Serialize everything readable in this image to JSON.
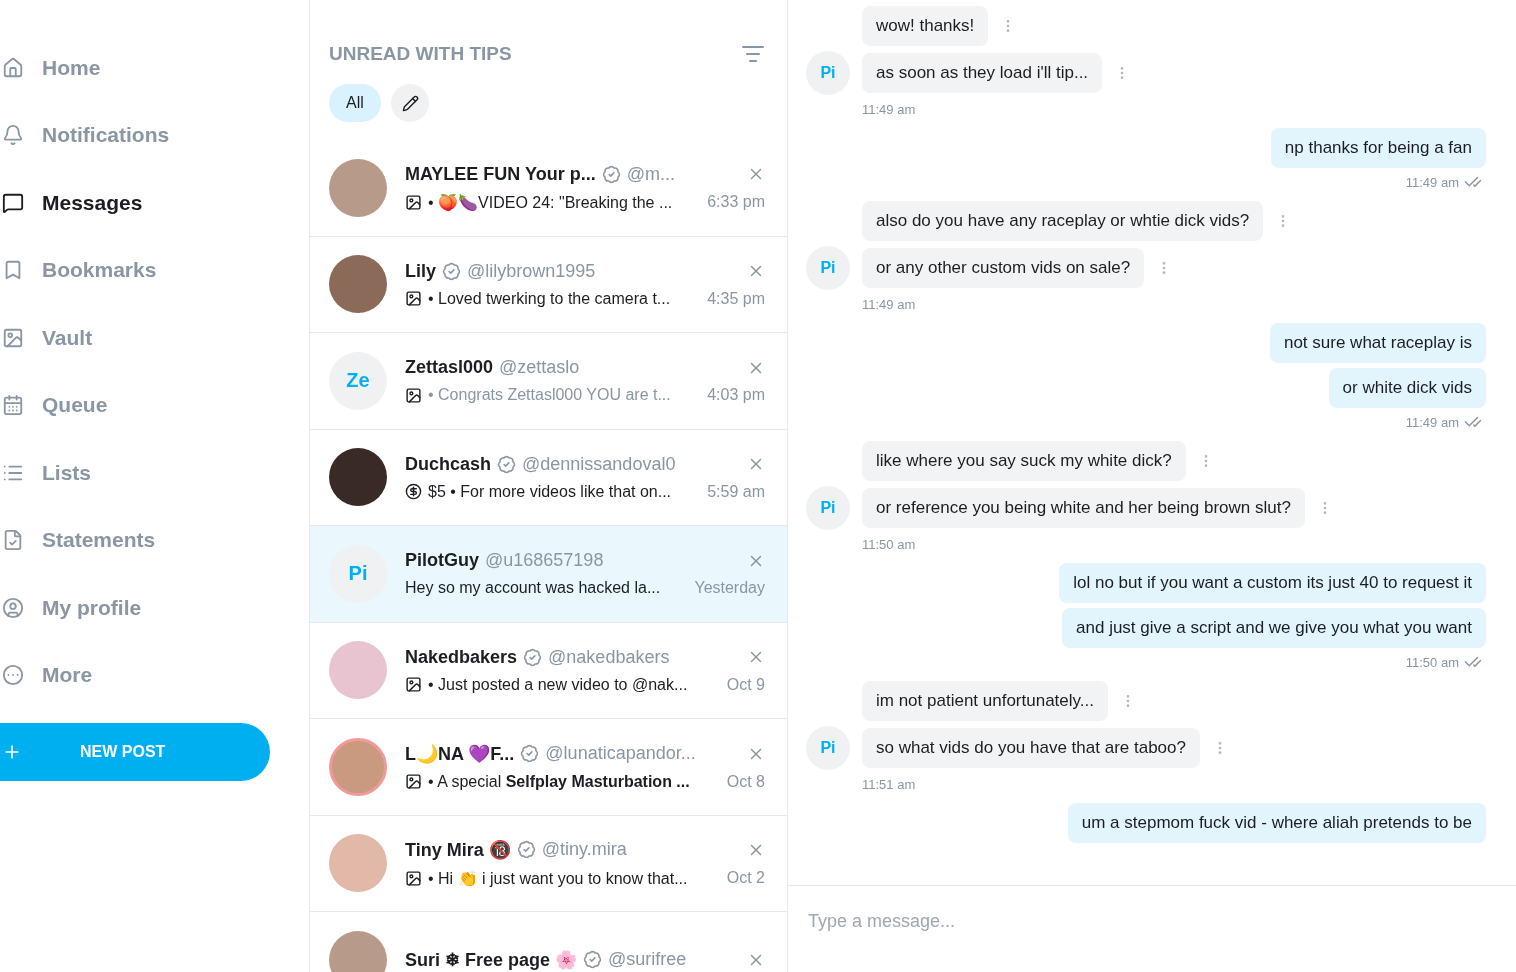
{
  "nav": {
    "items": [
      {
        "label": "Home",
        "selected": false
      },
      {
        "label": "Notifications",
        "selected": false
      },
      {
        "label": "Messages",
        "selected": true
      },
      {
        "label": "Bookmarks",
        "selected": false
      },
      {
        "label": "Vault",
        "selected": false
      },
      {
        "label": "Queue",
        "selected": false
      },
      {
        "label": "Lists",
        "selected": false
      },
      {
        "label": "Statements",
        "selected": false
      },
      {
        "label": "My profile",
        "selected": false
      },
      {
        "label": "More",
        "selected": false
      }
    ],
    "new_post": "NEW POST"
  },
  "chats": {
    "title": "UNREAD WITH TIPS",
    "filters": [
      {
        "label": "All",
        "selected": true
      }
    ],
    "conversations": [
      {
        "name": "MAYLEE FUN Your p...",
        "verified": true,
        "handle": "@m...",
        "avatar": {
          "kind": "photo"
        },
        "ring": false,
        "kind": "media",
        "preview": "• 🍑🍆VIDEO 24: \"Breaking the ...",
        "read": false,
        "time": "6:33 pm",
        "selected": false
      },
      {
        "name": "Lily",
        "verified": true,
        "handle": "@lilybrown1995",
        "avatar": {
          "kind": "photo"
        },
        "ring": false,
        "kind": "media",
        "preview": "• Loved twerking to the camera t...",
        "read": false,
        "time": "4:35 pm",
        "selected": false
      },
      {
        "name": "Zettasl000",
        "verified": false,
        "handle": "@zettaslo",
        "avatar": {
          "kind": "initials",
          "text": "Ze"
        },
        "ring": false,
        "kind": "media",
        "preview": "• Congrats Zettasl000 YOU are t...",
        "read": true,
        "time": "4:03 pm",
        "selected": false
      },
      {
        "name": "Duchcash",
        "verified": true,
        "handle": "@dennissandoval0",
        "avatar": {
          "kind": "photo"
        },
        "ring": false,
        "kind": "tip",
        "preview": "$5 • For more videos like that on...",
        "read": false,
        "time": "5:59 am",
        "selected": false
      },
      {
        "name": "PilotGuy",
        "verified": false,
        "handle": "@u168657198",
        "avatar": {
          "kind": "initials",
          "text": "Pi"
        },
        "ring": false,
        "kind": "text",
        "preview": "Hey so my account was hacked la...",
        "read": false,
        "time": "Yesterday",
        "selected": true
      },
      {
        "name": "Nakedbakers",
        "verified": true,
        "handle": "@nakedbakers",
        "avatar": {
          "kind": "photo"
        },
        "ring": false,
        "kind": "media",
        "preview": "• Just posted a new video to @nak...",
        "read": false,
        "time": "Oct 9",
        "selected": false
      },
      {
        "name": "L🌙NA 💜F...",
        "verified": true,
        "handle": "@lunaticapandor...",
        "avatar": {
          "kind": "photo"
        },
        "ring": true,
        "kind": "media",
        "preview": "• A special **Selfplay Masturbation ...**",
        "read": false,
        "time": "Oct 8",
        "selected": false
      },
      {
        "name": "Tiny Mira 🔞",
        "verified": true,
        "handle": "@tiny.mira",
        "avatar": {
          "kind": "photo"
        },
        "ring": false,
        "kind": "media",
        "preview": "• Hi 👏 i just want you to know that...",
        "read": false,
        "time": "Oct 2",
        "selected": false
      },
      {
        "name": "Suri ❄ Free page 🌸",
        "verified": true,
        "handle": "@surifree",
        "avatar": {
          "kind": "photo"
        },
        "ring": false,
        "kind": "none",
        "selected": false
      }
    ]
  },
  "thread": {
    "groups": [
      {
        "kind": "incoming",
        "initials": "Pi",
        "messages": [
          "wow! thanks!",
          "as soon as they load i'll tip..."
        ],
        "time": "11:49 am"
      },
      {
        "kind": "outgoing",
        "messages": [
          "np thanks for being a fan"
        ],
        "time": "11:49 am",
        "seen": true
      },
      {
        "kind": "incoming",
        "initials": "Pi",
        "messages": [
          "also do you have any raceplay or whtie dick vids?",
          "or any other custom vids on sale?"
        ],
        "time": "11:49 am"
      },
      {
        "kind": "outgoing",
        "messages": [
          "not sure what raceplay is",
          "or white dick vids"
        ],
        "time": "11:49 am",
        "seen": true
      },
      {
        "kind": "incoming",
        "initials": "Pi",
        "messages": [
          "like where you say suck my white dick?",
          "or reference you being white and her being brown slut?"
        ],
        "time": "11:50 am"
      },
      {
        "kind": "outgoing",
        "messages": [
          "lol no but if you want a custom its just 40 to request it",
          "and just give a script and we give you what you want"
        ],
        "time": "11:50 am",
        "seen": true
      },
      {
        "kind": "incoming",
        "initials": "Pi",
        "messages": [
          "im not patient unfortunately...",
          "so what vids do you have that are taboo?"
        ],
        "time": "11:51 am"
      },
      {
        "kind": "outgoing",
        "messages": [
          "um a stepmom fuck vid - where aliah pretends to be"
        ]
      }
    ],
    "composer": {
      "placeholder": "Type a message..."
    }
  }
}
